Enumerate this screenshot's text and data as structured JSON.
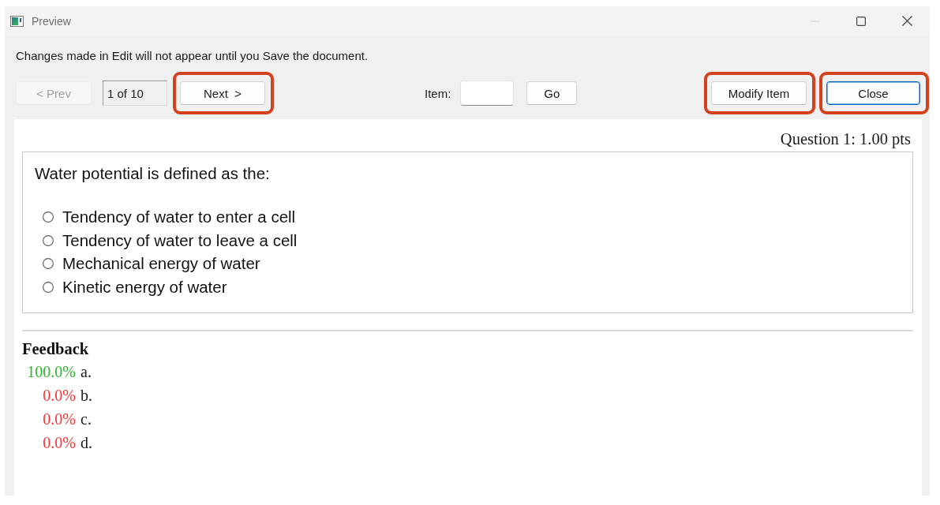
{
  "window": {
    "title": "Preview",
    "minimize_disabled": true
  },
  "notice": "Changes made in Edit will not appear until you Save the document.",
  "toolbar": {
    "prev_button": {
      "label": "< Prev",
      "disabled": true,
      "default": false
    },
    "page_counter": "1 of 10",
    "next_button": {
      "label": "Next  >",
      "disabled": false,
      "default": false,
      "highlighted": true
    },
    "item_label": "Item:",
    "go_button": {
      "label": "Go",
      "disabled": false,
      "default": false
    },
    "modify_button": {
      "label": "Modify Item",
      "disabled": false,
      "default": false,
      "highlighted": true
    },
    "close_button": {
      "label": "Close",
      "disabled": false,
      "default": true,
      "highlighted": true
    }
  },
  "question": {
    "points": "Question 1: 1.00 pts",
    "prompt": "Water potential is defined as the:",
    "options": [
      {
        "label": "Tendency of water to enter a cell",
        "selected": false
      },
      {
        "label": "Tendency of water to leave a cell",
        "selected": false
      },
      {
        "label": "Mechanical energy of water",
        "selected": false
      },
      {
        "label": "Kinetic energy of water",
        "selected": false
      }
    ]
  },
  "feedback": {
    "title": "Feedback",
    "rows": [
      {
        "percent": "100.0%",
        "letter": "a.",
        "color": "#2db52d"
      },
      {
        "percent": "0.0%",
        "letter": "b.",
        "color": "#ff3333"
      },
      {
        "percent": "0.0%",
        "letter": "c.",
        "color": "#ff3333"
      },
      {
        "percent": "0.0%",
        "letter": "d.",
        "color": "#ff3333"
      }
    ]
  }
}
